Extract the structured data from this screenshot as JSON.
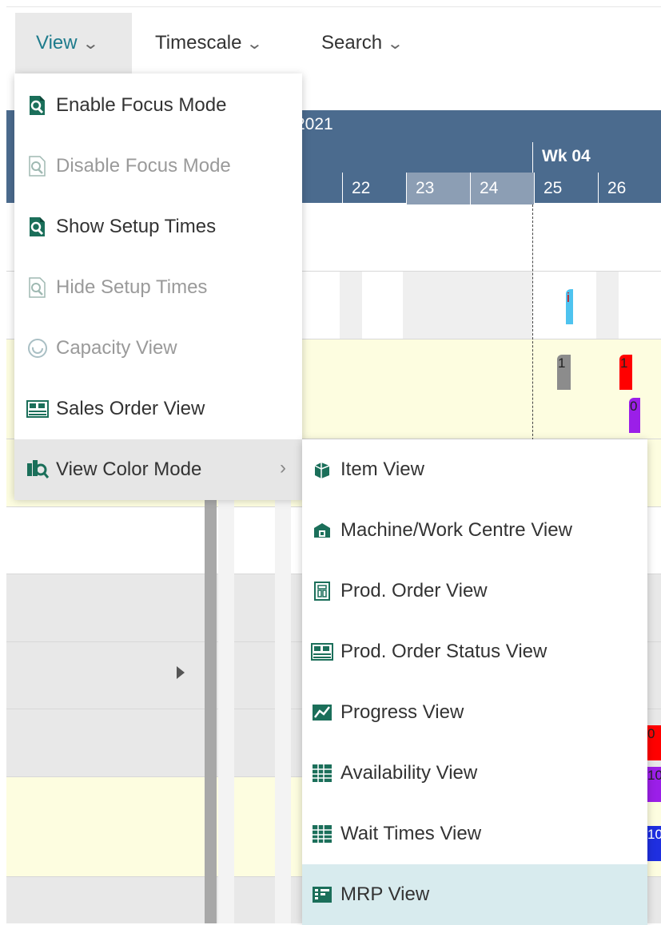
{
  "toolbar": {
    "view_label": "View",
    "timescale_label": "Timescale",
    "search_label": "Search"
  },
  "timeline": {
    "year_label": "2021",
    "week_label": "Wk 04",
    "days": [
      "",
      "22",
      "23",
      "24",
      "25",
      "26"
    ]
  },
  "bars": {
    "b1": "i",
    "b2": "1",
    "b3": "1",
    "b4": "0",
    "b5": "10",
    "b6": "10"
  },
  "view_menu": {
    "items": [
      {
        "label": "Enable Focus Mode",
        "icon": "focus-mode-icon"
      },
      {
        "label": "Disable Focus Mode",
        "icon": "focus-mode-off-icon"
      },
      {
        "label": "Show Setup Times",
        "icon": "setup-times-icon"
      },
      {
        "label": "Hide Setup Times",
        "icon": "setup-times-off-icon"
      },
      {
        "label": "Capacity View",
        "icon": "capacity-icon"
      },
      {
        "label": "Sales Order View",
        "icon": "sales-order-icon"
      },
      {
        "label": "View Color Mode",
        "icon": "color-mode-icon"
      }
    ]
  },
  "color_menu": {
    "items": [
      {
        "label": "Item View",
        "icon": "item-icon"
      },
      {
        "label": "Machine/Work Centre View",
        "icon": "machine-icon"
      },
      {
        "label": "Prod. Order View",
        "icon": "prod-order-icon"
      },
      {
        "label": "Prod. Order Status View",
        "icon": "prod-order-status-icon"
      },
      {
        "label": "Progress View",
        "icon": "progress-icon"
      },
      {
        "label": "Availability View",
        "icon": "availability-icon"
      },
      {
        "label": "Wait Times View",
        "icon": "wait-times-icon"
      },
      {
        "label": "MRP View",
        "icon": "mrp-icon"
      }
    ]
  },
  "colors": {
    "accent": "#1e7b8c",
    "header_bg": "#4b6b8e",
    "highlight_row": "#fdfde0",
    "selected_item": "#d8ebee"
  }
}
